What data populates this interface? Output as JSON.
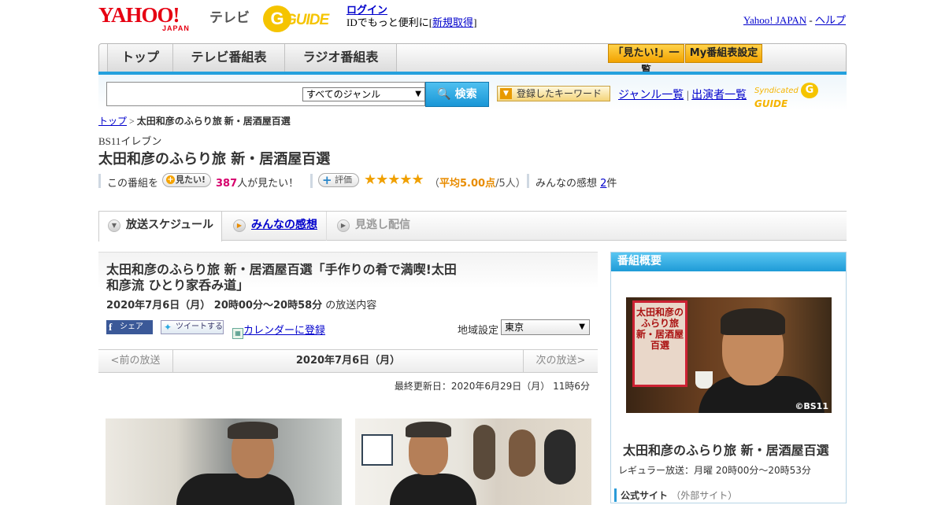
{
  "header": {
    "logo_yahoo": "YAHOO!",
    "logo_japan": "JAPAN",
    "tv_label": "テレビ",
    "gguide_g": "G",
    "gguide_word": "GUIDE",
    "login": "ログイン",
    "login_prefix": "IDでもっと便利に[",
    "signup": "新規取得",
    "login_suffix": "]",
    "yahoo_japan_link": "Yahoo! JAPAN",
    "dash": " - ",
    "help_link": "ヘルプ"
  },
  "nav": {
    "tabs": [
      "トップ",
      "テレビ番組表",
      "ラジオ番組表"
    ],
    "mitai_list": "「見たい!」一覧",
    "my_schedule": "My番組表設定"
  },
  "search": {
    "genre_selected": "すべてのジャンル",
    "search_button": "検索",
    "keyword_button": "登録したキーワード",
    "genre_list": "ジャンル一覧",
    "divider": "|",
    "cast_list": "出演者一覧",
    "syndicated": "Syndicated",
    "syndicated_g": "G",
    "syndicated_word": "GUIDE"
  },
  "breadcrumb": {
    "top": "トップ",
    "sep": " > ",
    "current": "太田和彦のふらり旅 新・居酒屋百選"
  },
  "program": {
    "channel": "BS11イレブン",
    "title": "太田和彦のふらり旅 新・居酒屋百選",
    "want_prefix": "この番組を",
    "want_button": "見たい!",
    "want_count": "387",
    "want_suffix": "人が見たい！",
    "rating_button": "評価",
    "stars": "★★★★★",
    "avg_open": "（",
    "avg_score": "平均5.00点",
    "avg_people": "/5人）",
    "kanso_label": "みんなの感想 ",
    "kanso_count": "2",
    "kanso_suffix": "件"
  },
  "subtabs": [
    "放送スケジュール",
    "みんなの感想",
    "見逃し配信"
  ],
  "episode": {
    "title": "太田和彦のふらり旅 新・居酒屋百選「手作りの肴で満喫!太田和彦流 ひとり家呑み道」",
    "date": "2020年7月6日（月） 20時00分～20時58分",
    "date_suffix": " の放送内容",
    "share_fb": "シェア",
    "share_tw": "ツイートする",
    "calendar": "カレンダーに登録",
    "region_label": "地域設定",
    "region_value": "東京"
  },
  "prevnext": {
    "prev": "<前の放送",
    "date": "2020年7月6日（月）",
    "next": "次の放送>"
  },
  "updated": "最終更新日：2020年6月29日（月） 11時6分",
  "sidebar": {
    "header": "番組概要",
    "sign_text": "太田和彦のふらり旅新・居酒屋百選",
    "copyright": "©BS11",
    "title": "太田和彦のふらり旅 新・居酒屋百選",
    "regular": "レギュラー放送：月曜 20時00分～20時53分",
    "official": "公式サイト",
    "official_note": "（外部サイト）"
  },
  "colors": {
    "accent_blue": "#23a0dd",
    "yahoo_red": "#e60012",
    "gguide_yellow": "#f5c400",
    "want_count": "#d6006c",
    "avg_score": "#e88c00"
  },
  "icons": {
    "search_button": "search-icon",
    "keyword_button": "dropdown-icon",
    "subtab": "circle-arrow-icon",
    "calendar": "calendar-icon",
    "facebook": "facebook-icon",
    "twitter": "twitter-icon"
  }
}
